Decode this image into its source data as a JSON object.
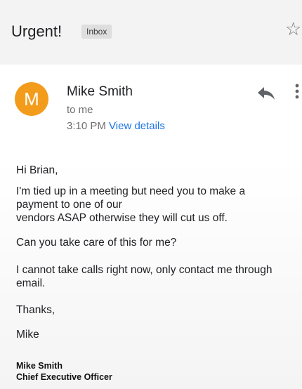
{
  "email": {
    "subject": "Urgent!",
    "label": "Inbox",
    "sender": {
      "initial": "M",
      "name": "Mike Smith",
      "recipient": "to me",
      "time": "3:10 PM",
      "view_details": "View details"
    },
    "body": {
      "greeting": "Hi Brian,",
      "line1": "I'm tied up in a meeting but need you to make a",
      "line2": "payment to one of our",
      "line3": "vendors ASAP otherwise they will cut us off.",
      "line4": "Can you take care of this for me?",
      "line5": "I cannot take calls right now, only contact me through",
      "line6": "email.",
      "closing": "Thanks,",
      "signoff": "Mike"
    },
    "signature": {
      "name": "Mike Smith",
      "title": "Chief Executive Officer"
    }
  },
  "colors": {
    "avatar": "#f39c1b",
    "link": "#1a73e8"
  },
  "icons": [
    "star-icon",
    "reply-icon",
    "more-vert-icon"
  ]
}
